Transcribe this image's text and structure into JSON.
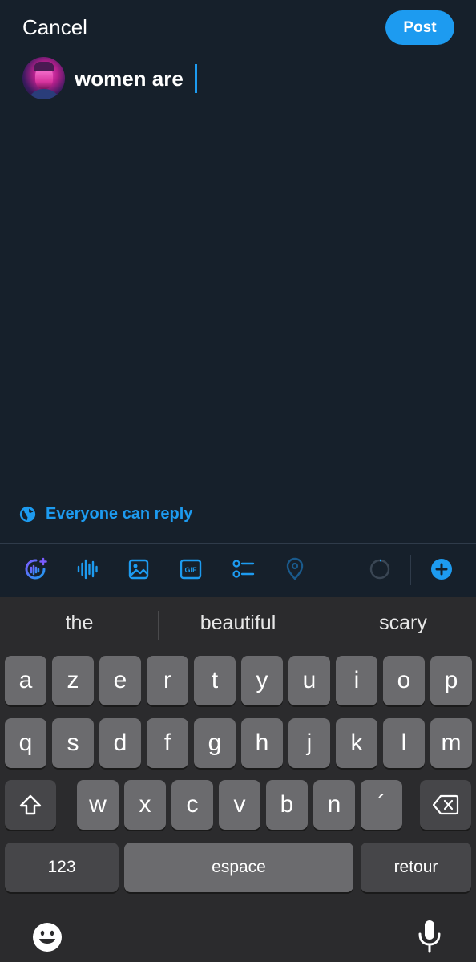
{
  "header": {
    "cancel_label": "Cancel",
    "post_label": "Post"
  },
  "compose": {
    "text": "women are"
  },
  "reply": {
    "label": "Everyone can reply"
  },
  "toolbar": {
    "icons": [
      "grok-icon",
      "voice-icon",
      "image-icon",
      "gif-icon",
      "poll-icon",
      "location-icon",
      "char-counter-icon",
      "add-thread-icon"
    ],
    "gif_text": "GIF"
  },
  "keyboard": {
    "suggestions": [
      "the",
      "beautiful",
      "scary"
    ],
    "row1": [
      "a",
      "z",
      "e",
      "r",
      "t",
      "y",
      "u",
      "i",
      "o",
      "p"
    ],
    "row2": [
      "q",
      "s",
      "d",
      "f",
      "g",
      "h",
      "j",
      "k",
      "l",
      "m"
    ],
    "row3": [
      "w",
      "x",
      "c",
      "v",
      "b",
      "n",
      "´"
    ],
    "numbers_label": "123",
    "space_label": "espace",
    "return_label": "retour"
  },
  "colors": {
    "accent": "#1d9bf0",
    "background": "#15202b",
    "keyboard": "#2b2b2d"
  }
}
